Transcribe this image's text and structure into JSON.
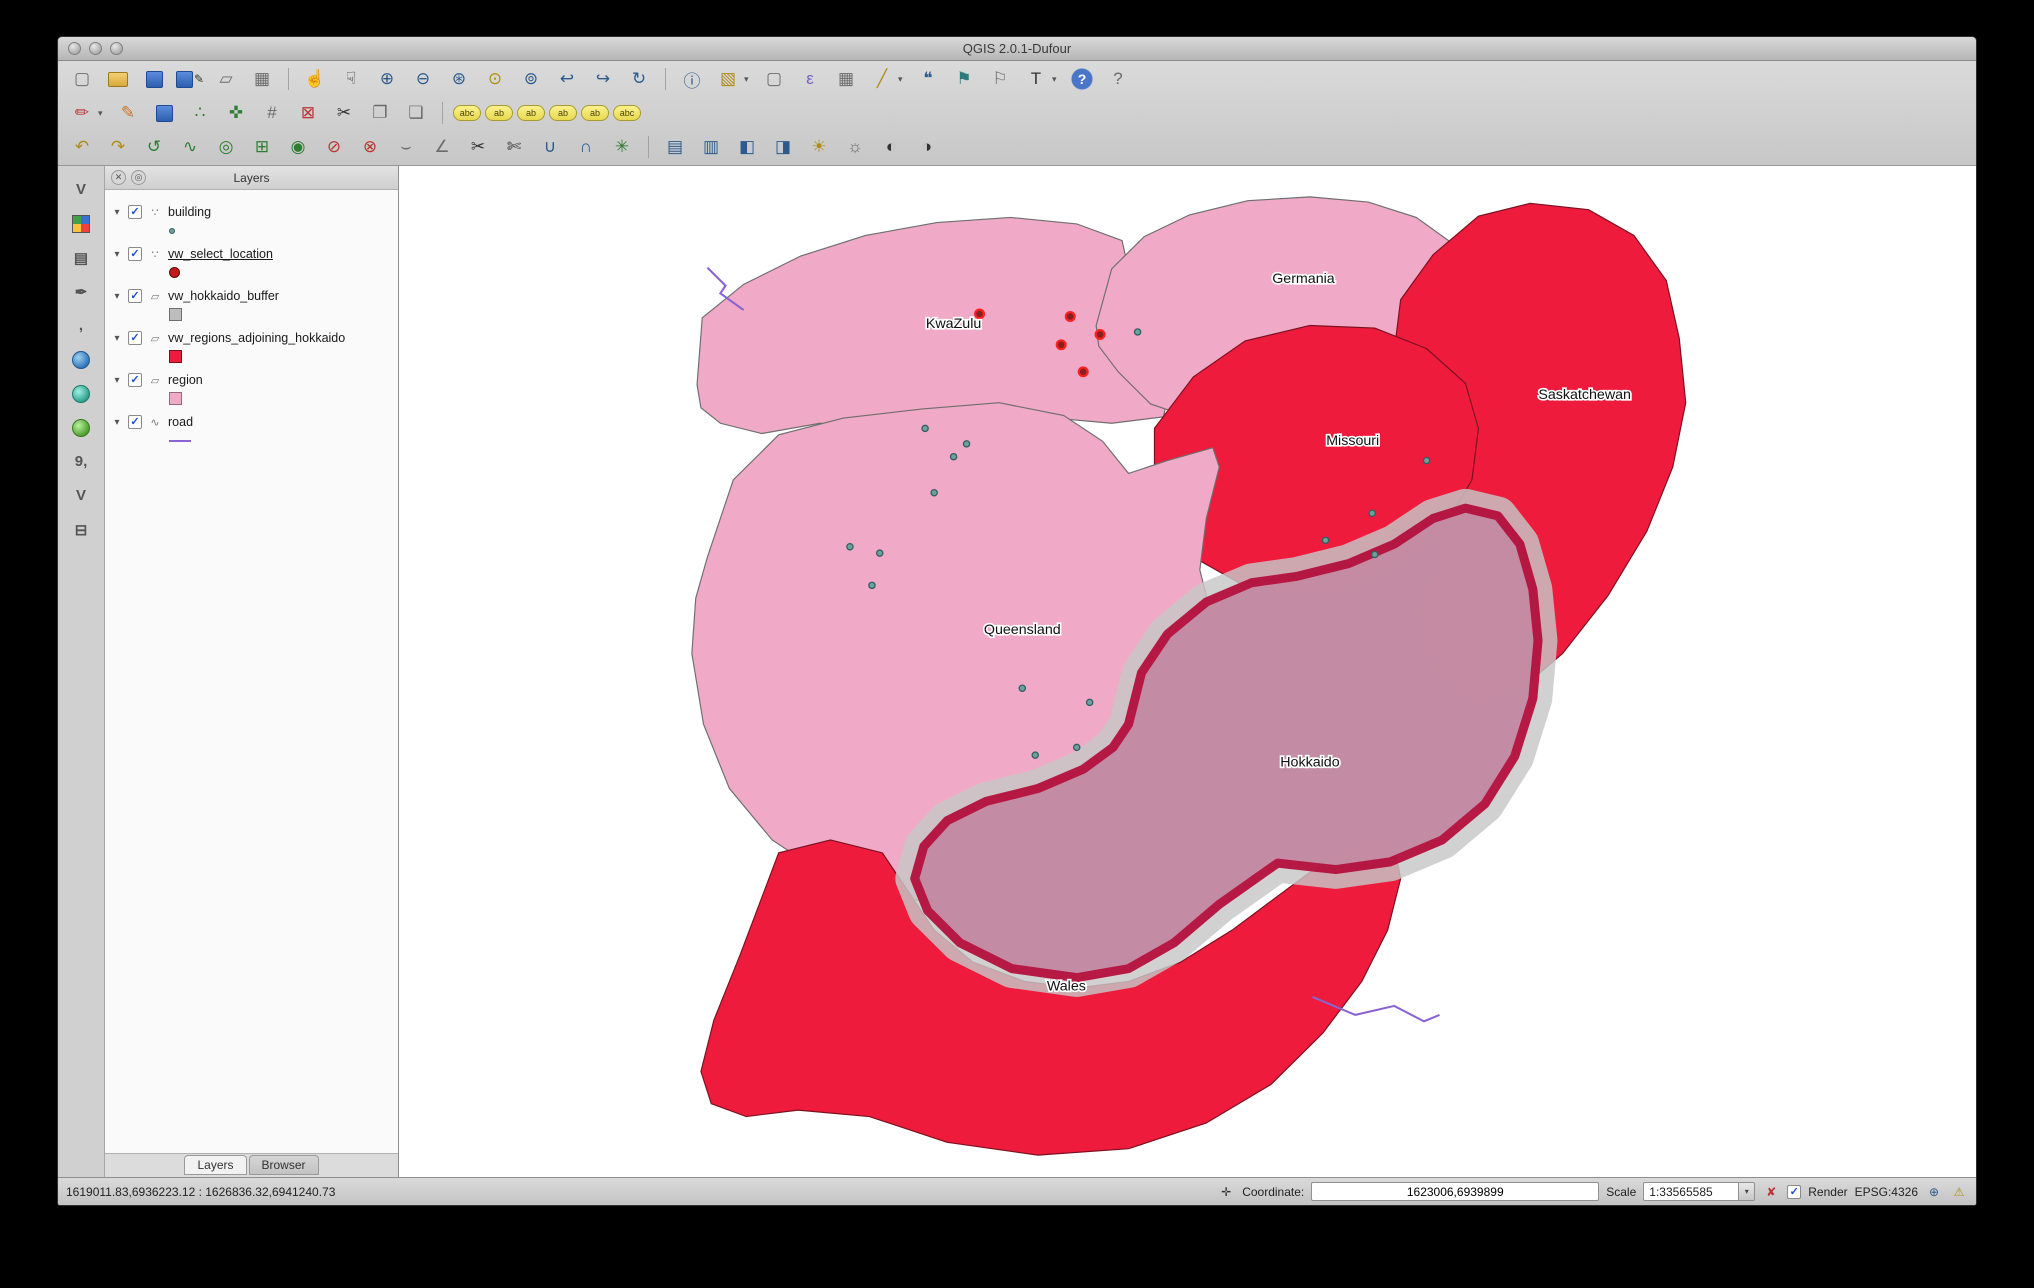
{
  "window": {
    "title": "QGIS 2.0.1-Dufour"
  },
  "icons": {
    "disclosure": "▾",
    "check": "✓",
    "dropdown": "▾",
    "panel_close": "✕",
    "panel_float": "◎",
    "new_project": "▢",
    "open_project": "",
    "save_project": "",
    "save_project_as": "✎",
    "new_composer": "▱",
    "composer_manager": "▦",
    "pan_map": "☝",
    "pan_to_selection": "☟",
    "zoom_in": "⊕",
    "zoom_out": "⊖",
    "zoom_full": "⊛",
    "zoom_to_selection": "⊙",
    "zoom_to_layer": "⊚",
    "zoom_last": "↩",
    "zoom_next": "↪",
    "refresh": "↻",
    "identify": "ⓘ",
    "select_features": "▧",
    "deselect": "▢",
    "select_by_expression": "ε",
    "attribute_table": "▦",
    "measure": "╱",
    "map_tips": "❝",
    "new_bookmark": "⚑",
    "show_bookmarks": "⚐",
    "annotation": "T",
    "help": "?",
    "whats_this": "?",
    "current_edits": "✏",
    "toggle_editing": "✎",
    "save_edits": "",
    "add_feature": "∴",
    "move_feature": "✜",
    "node_tool": "#",
    "delete_selected": "⊠",
    "cut_features": "✂",
    "copy_features": "❐",
    "paste_features": "❏",
    "labeling": "abc",
    "label_move": "ab",
    "label_rotate": "ab",
    "label_pin": "ab",
    "label_toggle": "ab",
    "label_change": "abc",
    "undo": "↶",
    "redo": "↷",
    "rotate_feature": "↺",
    "simplify_feature": "∿",
    "add_ring": "◎",
    "add_part": "⊞",
    "fill_ring": "◉",
    "delete_ring": "⊘",
    "delete_part": "⊗",
    "offset_curve": "⌣",
    "reshape": "∠",
    "split_features": "✂",
    "split_parts": "✄",
    "merge_features": "∪",
    "merge_attributes": "∩",
    "rotate_point_symbols": "✳",
    "local_histogram_stretch": "▤",
    "full_histogram_stretch": "▥",
    "local_contrast": "◧",
    "full_contrast": "◨",
    "increase_brightness": "☀",
    "decrease_brightness": "☼",
    "increase_contrast": "◐",
    "decrease_contrast": "◑",
    "add_vector_layer": "V",
    "add_raster_layer": "",
    "add_database_layer": "▤",
    "add_spatialite_layer": "✒",
    "add_mssql_layer": ",",
    "add_wms_layer": "",
    "add_wcs_layer": "",
    "add_wfs_layer": "",
    "add_oracle_layer": "9,",
    "new_shapefile_layer": "V",
    "remove_layer": "⊟",
    "extents_toggle": "✛",
    "stop_rendering": "✘",
    "crs_status": "⊕",
    "log_messages": "⚠",
    "layer_point": "∵",
    "layer_polygon": "▱",
    "layer_line": "∿"
  },
  "layers_panel": {
    "title": "Layers",
    "items": [
      {
        "label": "building"
      },
      {
        "label": "vw_select_location"
      },
      {
        "label": "vw_hokkaido_buffer"
      },
      {
        "label": "vw_regions_adjoining_hokkaido"
      },
      {
        "label": "region"
      },
      {
        "label": "road"
      }
    ],
    "tabs": {
      "layers": "Layers",
      "browser": "Browser"
    }
  },
  "map": {
    "labels": {
      "germania": "Germania",
      "kwazulu": "KwaZulu",
      "saskatchewan": "Saskatchewan",
      "missouri": "Missouri",
      "queensland": "Queensland",
      "hokkaido": "Hokkaido",
      "wales": "Wales"
    },
    "colors": {
      "region_pink": "#f0a9c6",
      "adjoining_red": "#ee1b3d",
      "hokkaido_mauve": "#c48aa3",
      "hokkaido_border": "#b5123f",
      "buffer_gray": "#c8c8c8",
      "road_purple": "#8a63d2",
      "point_teal": "#6fa0a0",
      "selected_point_red": "#8a1f1f"
    }
  },
  "status_bar": {
    "extents": "1619011.83,6936223.12 : 1626836.32,6941240.73",
    "coordinate_label": "Coordinate:",
    "coordinate_value": "1623006,6939899",
    "scale_label": "Scale",
    "scale_value": "1:33565585",
    "render_label": "Render",
    "epsg": "EPSG:4326"
  }
}
